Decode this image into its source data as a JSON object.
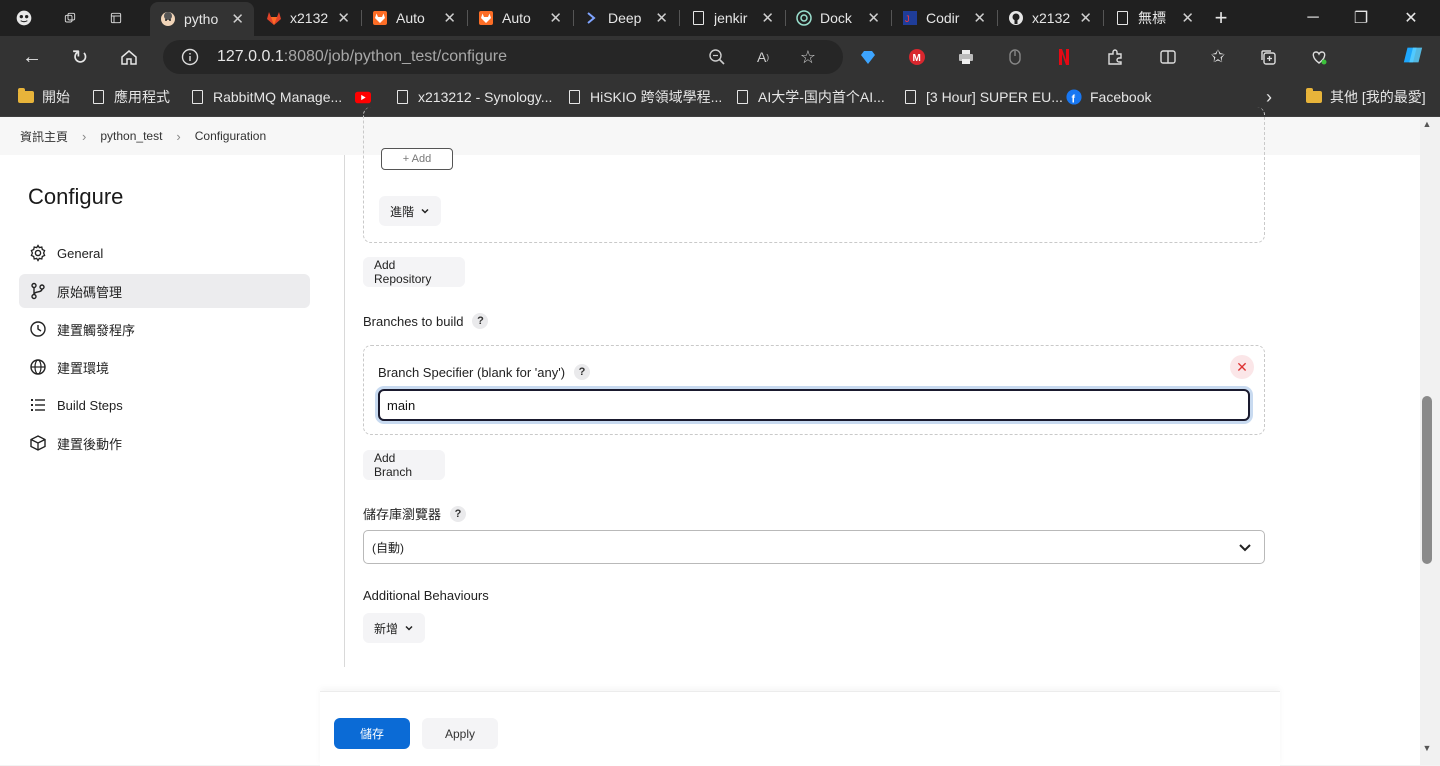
{
  "browser": {
    "tabs": [
      {
        "title": "pytho",
        "icon": "face-favicon-icon",
        "active": true
      },
      {
        "title": "x2132",
        "icon": "gitlab-icon"
      },
      {
        "title": "Auto",
        "icon": "gitlab-orange-icon"
      },
      {
        "title": "Auto",
        "icon": "gitlab-orange-icon"
      },
      {
        "title": "Deep",
        "icon": "deepl-icon"
      },
      {
        "title": "jenkir",
        "icon": "document-icon"
      },
      {
        "title": "Dock",
        "icon": "chatgpt-icon"
      },
      {
        "title": "Codir",
        "icon": "jetbrains-icon"
      },
      {
        "title": "x2132",
        "icon": "github-icon"
      },
      {
        "title": "無標",
        "icon": "document-icon"
      }
    ],
    "url_host": "127.0.0.1",
    "url_rest": ":8080/job/python_test/configure"
  },
  "bookmarks": {
    "items": [
      {
        "label": "開始",
        "icon": "folder-icon"
      },
      {
        "label": "應用程式",
        "icon": "page-icon"
      },
      {
        "label": "RabbitMQ Manage...",
        "icon": "page-icon"
      },
      {
        "label": "",
        "icon": "youtube-icon"
      },
      {
        "label": "x213212 - Synology...",
        "icon": "page-icon"
      },
      {
        "label": "HiSKIO 跨領域學程...",
        "icon": "page-icon"
      },
      {
        "label": "AI大学-国内首个AI...",
        "icon": "page-icon"
      },
      {
        "label": "[3 Hour] SUPER EU...",
        "icon": "page-icon"
      },
      {
        "label": "Facebook",
        "icon": "facebook-icon"
      }
    ],
    "other": "其他 [我的最愛]"
  },
  "breadcrumb": {
    "items": [
      "資訊主頁",
      "python_test",
      "Configuration"
    ]
  },
  "sidebar": {
    "title": "Configure",
    "items": [
      {
        "label": "General",
        "icon": "gear-icon"
      },
      {
        "label": "原始碼管理",
        "icon": "branch-icon",
        "selected": true
      },
      {
        "label": "建置觸發程序",
        "icon": "clock-icon"
      },
      {
        "label": "建置環境",
        "icon": "globe-icon"
      },
      {
        "label": "Build Steps",
        "icon": "list-icon"
      },
      {
        "label": "建置後動作",
        "icon": "package-icon"
      }
    ]
  },
  "main": {
    "add_button": "+ Add",
    "advanced_button": "進階",
    "add_repository": "Add Repository",
    "branches_label": "Branches to build",
    "branch_specifier_label": "Branch Specifier (blank for 'any')",
    "branch_value": "main",
    "add_branch": "Add Branch",
    "repo_browser_label": "儲存庫瀏覽器",
    "repo_browser_value": "(自動)",
    "additional_label": "Additional Behaviours",
    "new_button": "新增",
    "help_glyph": "?"
  },
  "footer": {
    "save": "儲存",
    "apply": "Apply"
  }
}
